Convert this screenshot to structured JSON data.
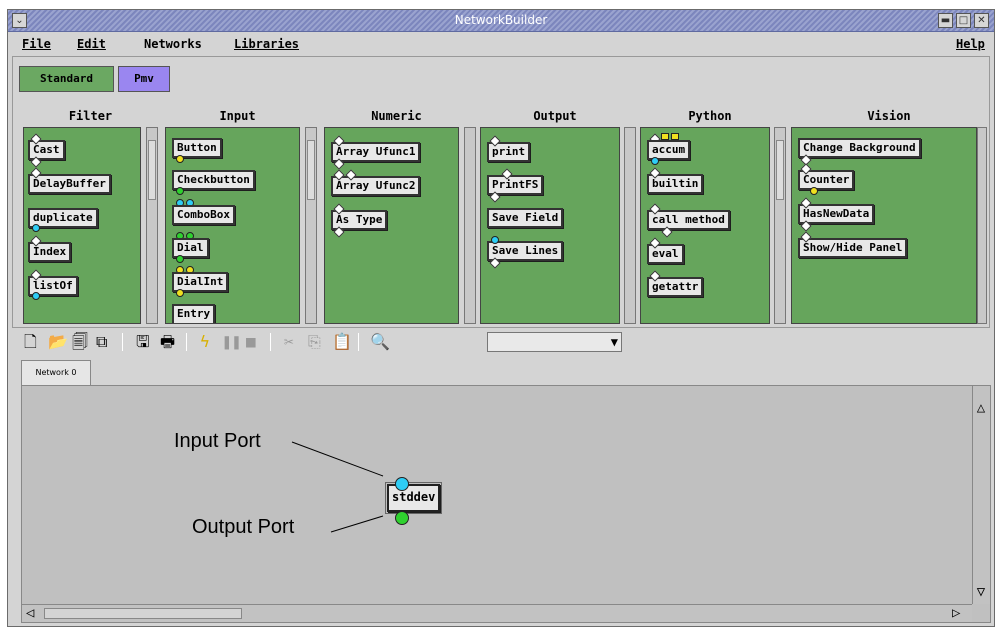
{
  "window": {
    "title": "NetworkBuilder",
    "minimize_label": "▬",
    "maximize_label": "□",
    "close_label": "✕"
  },
  "menu": {
    "file": "File",
    "edit": "Edit",
    "networks": "Networks",
    "libraries": "Libraries",
    "help": "Help"
  },
  "palette_tabs": [
    {
      "label": "Standard",
      "color": "#6ba862"
    },
    {
      "label": "Pmv",
      "color": "#9a86f0"
    }
  ],
  "categories": [
    {
      "title": "Filter",
      "items": [
        "Cast",
        "DelayBuffer",
        "duplicate",
        "Index",
        "listOf"
      ]
    },
    {
      "title": "Input",
      "items": [
        "Button",
        "Checkbutton",
        "ComboBox",
        "Dial",
        "DialInt",
        "Entry"
      ]
    },
    {
      "title": "Numeric",
      "items": [
        "Array Ufunc1",
        "Array Ufunc2",
        "As Type"
      ]
    },
    {
      "title": "Output",
      "items": [
        "print",
        "PrintFS",
        "Save Field",
        "Save Lines"
      ]
    },
    {
      "title": "Python",
      "items": [
        "accum",
        "builtin",
        "call method",
        "eval",
        "getattr"
      ]
    },
    {
      "title": "Vision",
      "items": [
        "Change Background",
        "Counter",
        "HasNewData",
        "Show/Hide Panel"
      ]
    }
  ],
  "toolbar": {
    "combo_value": ""
  },
  "network_tab": {
    "label": "Network 0"
  },
  "canvas": {
    "node_label": "stddev",
    "input_port_label": "Input Port",
    "output_port_label": "Output Port"
  },
  "colors": {
    "palette_green": "#66a55c",
    "input_port": "#2ecdf5",
    "output_port": "#2fd12f",
    "title_bar": "#8890c5"
  },
  "icons": [
    "new-file-icon",
    "open-folder-icon",
    "open-network-icon",
    "merge-network-icon",
    "save-icon",
    "print-icon",
    "run-icon",
    "pause-icon",
    "stop-icon",
    "cut-icon",
    "copy-icon",
    "paste-icon",
    "find-icon"
  ]
}
